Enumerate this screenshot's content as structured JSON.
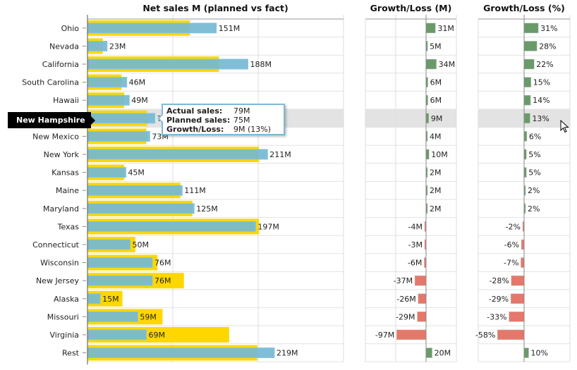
{
  "chart_data": [
    {
      "type": "bar",
      "title": "Net sales M (planned vs fact)",
      "orientation": "horizontal",
      "categories": [
        "Ohio",
        "Nevada",
        "California",
        "South Carolina",
        "Hawaii",
        "New Hampshire",
        "New Mexico",
        "New York",
        "Kansas",
        "Maine",
        "Maryland",
        "Texas",
        "Connecticut",
        "Wisconsin",
        "New Jersey",
        "Alaska",
        "Missouri",
        "Virginia",
        "Rest"
      ],
      "series": [
        {
          "name": "Planned sales",
          "color": "#ffd700",
          "values": [
            120,
            18,
            154,
            40,
            43,
            70,
            69,
            201,
            43,
            109,
            123,
            201,
            56,
            82,
            113,
            41,
            88,
            166,
            199
          ]
        },
        {
          "name": "Actual sales",
          "color": "#74b8d3",
          "values": [
            151,
            23,
            188,
            46,
            49,
            79,
            73,
            211,
            45,
            111,
            125,
            197,
            50,
            76,
            76,
            15,
            59,
            69,
            219
          ]
        }
      ],
      "data_labels": [
        "151M",
        "23M",
        "188M",
        "46M",
        "49M",
        "79M",
        "73M",
        "211M",
        "45M",
        "111M",
        "125M",
        "197M",
        "50M",
        "76M",
        "76M",
        "15M",
        "59M",
        "69M",
        "219M"
      ],
      "xlim": [
        0,
        300
      ],
      "grid": true
    },
    {
      "type": "bar",
      "title": "Growth/Loss (M)",
      "orientation": "horizontal",
      "categories": [
        "Ohio",
        "Nevada",
        "California",
        "South Carolina",
        "Hawaii",
        "New Hampshire",
        "New Mexico",
        "New York",
        "Kansas",
        "Maine",
        "Maryland",
        "Texas",
        "Connecticut",
        "Wisconsin",
        "New Jersey",
        "Alaska",
        "Missouri",
        "Virginia",
        "Rest"
      ],
      "values": [
        31,
        5,
        34,
        6,
        6,
        9,
        4,
        10,
        2,
        2,
        2,
        -4,
        -3,
        -6,
        -37,
        -26,
        -29,
        -97,
        20
      ],
      "data_labels": [
        "31M",
        "5M",
        "34M",
        "6M",
        "6M",
        "9M",
        "4M",
        "10M",
        "2M",
        "2M",
        "2M",
        "-4M",
        "-3M",
        "-6M",
        "-37M",
        "-26M",
        "-29M",
        "-97M",
        "20M"
      ],
      "positive_color": "#6a9a6a",
      "negative_color": "#e5776b",
      "xlim": [
        -200,
        100
      ],
      "grid": true
    },
    {
      "type": "bar",
      "title": "Growth/Loss (%)",
      "orientation": "horizontal",
      "categories": [
        "Ohio",
        "Nevada",
        "California",
        "South Carolina",
        "Hawaii",
        "New Hampshire",
        "New Mexico",
        "New York",
        "Kansas",
        "Maine",
        "Maryland",
        "Texas",
        "Connecticut",
        "Wisconsin",
        "New Jersey",
        "Alaska",
        "Missouri",
        "Virginia",
        "Rest"
      ],
      "values": [
        31,
        28,
        22,
        15,
        14,
        13,
        6,
        5,
        5,
        2,
        2,
        -2,
        -6,
        -7,
        -28,
        -29,
        -33,
        -58,
        10
      ],
      "data_labels": [
        "31%",
        "28%",
        "22%",
        "15%",
        "14%",
        "13%",
        "6%",
        "5%",
        "5%",
        "2%",
        "2%",
        "-2%",
        "-6%",
        "-7%",
        "-28%",
        "-29%",
        "-33%",
        "-58%",
        "10%"
      ],
      "positive_color": "#6a9a6a",
      "negative_color": "#e5776b",
      "xlim": [
        -100,
        100
      ],
      "grid": true
    }
  ],
  "highlight": {
    "category": "New Hampshire",
    "index": 5
  },
  "tooltip": {
    "rows": [
      {
        "key": "Actual sales:",
        "value": "79M"
      },
      {
        "key": "Planned sales:",
        "value": "75M"
      },
      {
        "key": "Growth/Loss:",
        "value": "9M (13%)"
      }
    ]
  }
}
